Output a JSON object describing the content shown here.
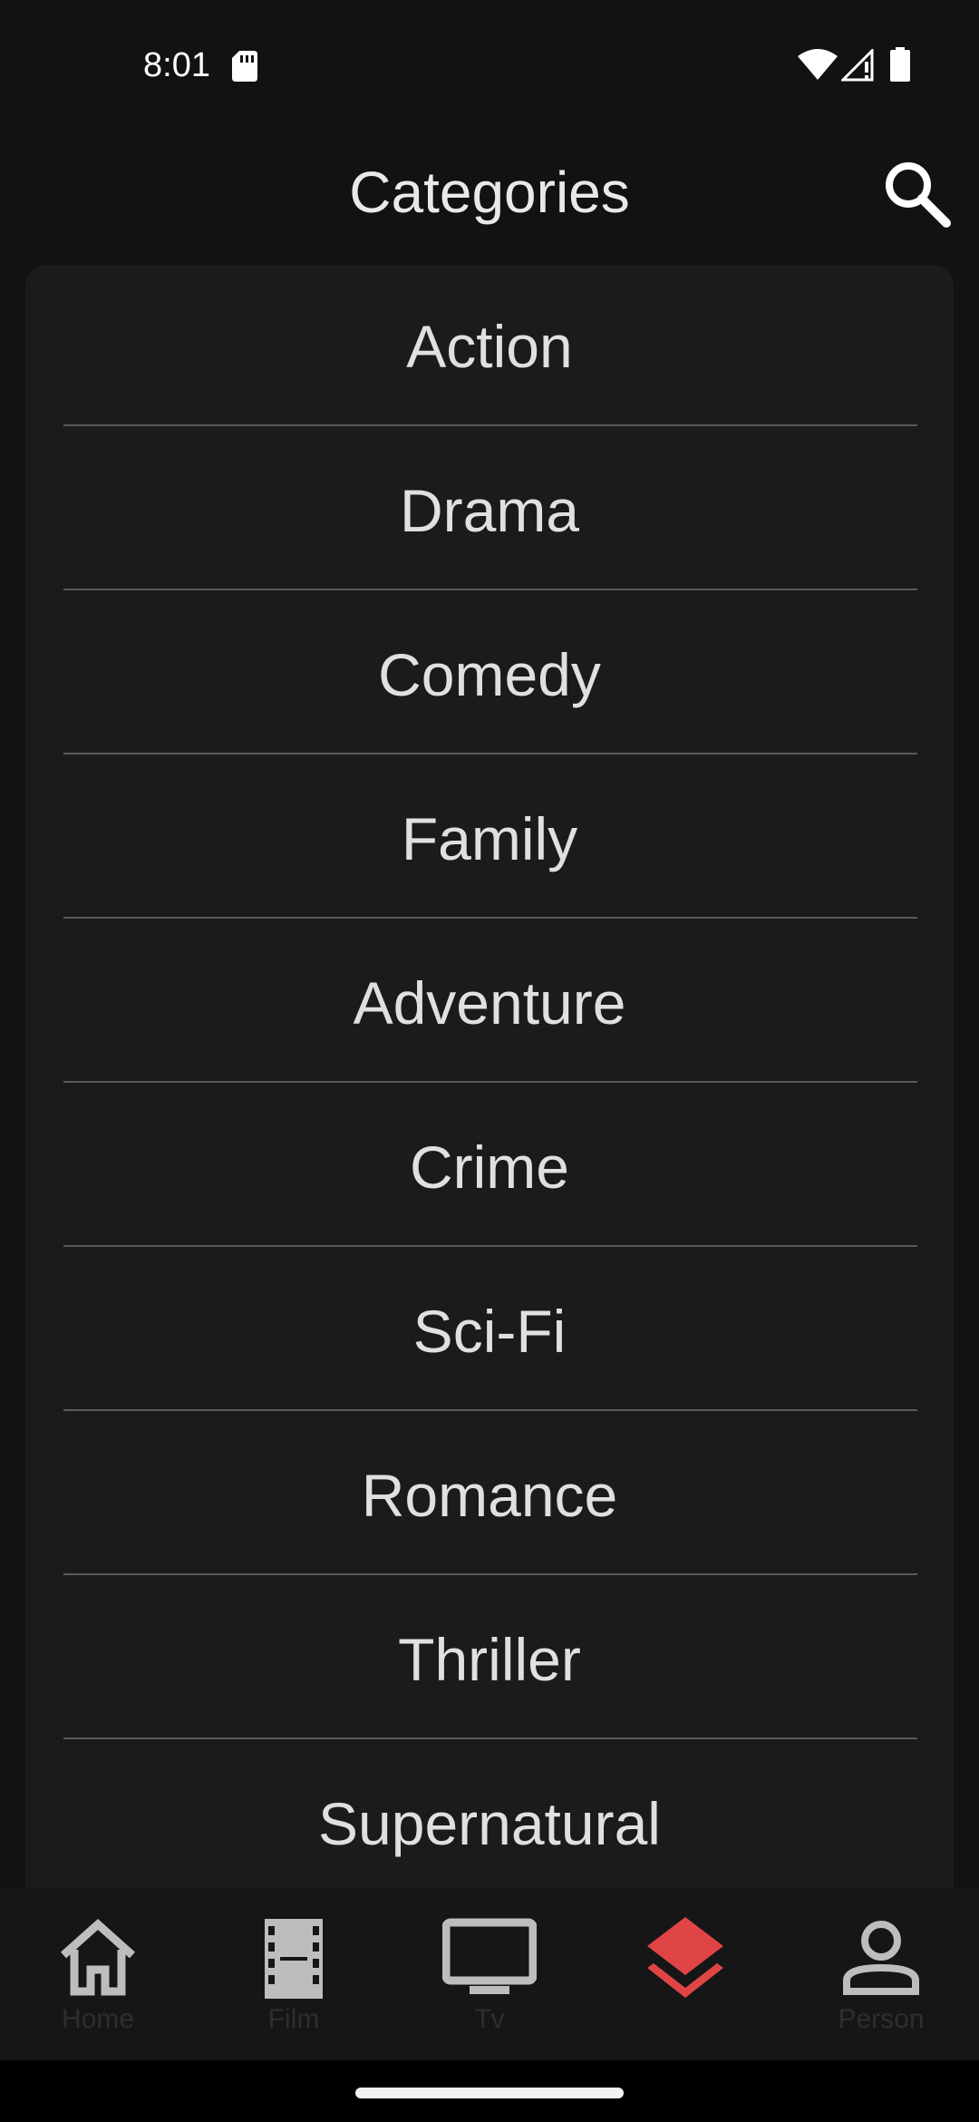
{
  "status_bar": {
    "time": "8:01",
    "icons": [
      "sd-card-icon",
      "wifi-icon",
      "signal-icon",
      "battery-icon"
    ]
  },
  "header": {
    "title": "Categories",
    "search_icon": "search-icon"
  },
  "categories": [
    "Action",
    "Drama",
    "Comedy",
    "Family",
    "Adventure",
    "Crime",
    "Sci-Fi",
    "Romance",
    "Thriller",
    "Supernatural"
  ],
  "bottom_nav": {
    "active_index": 3,
    "active_color": "#e04545",
    "inactive_color": "#bdbdbd",
    "items": [
      {
        "label": "Home",
        "icon": "home-icon"
      },
      {
        "label": "Film",
        "icon": "film-icon"
      },
      {
        "label": "Tv",
        "icon": "tv-icon"
      },
      {
        "label": "",
        "icon": "layers-icon"
      },
      {
        "label": "Person",
        "icon": "person-icon"
      }
    ]
  },
  "colors": {
    "background": "#121212",
    "card": "#1b1b1b",
    "divider": "#5a5a5a",
    "text": "#e0e0e0"
  }
}
